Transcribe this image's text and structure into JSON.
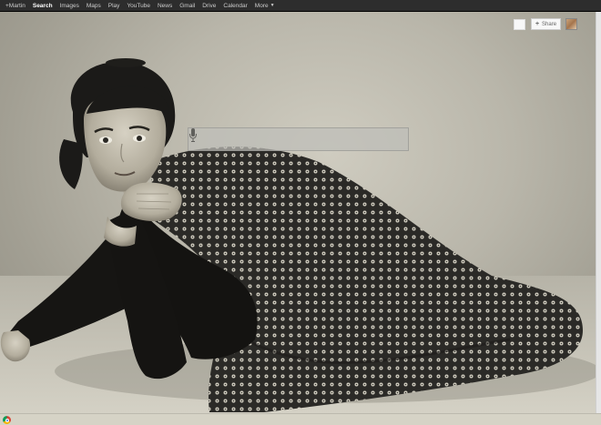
{
  "topbar": {
    "items": [
      {
        "label": "+Martin",
        "active": false
      },
      {
        "label": "Search",
        "active": true
      },
      {
        "label": "Images",
        "active": false
      },
      {
        "label": "Maps",
        "active": false
      },
      {
        "label": "Play",
        "active": false
      },
      {
        "label": "YouTube",
        "active": false
      },
      {
        "label": "News",
        "active": false
      },
      {
        "label": "Gmail",
        "active": false
      },
      {
        "label": "Drive",
        "active": false
      },
      {
        "label": "Calendar",
        "active": false
      },
      {
        "label": "More",
        "active": false
      }
    ]
  },
  "search": {
    "value": "",
    "placeholder": ""
  },
  "header_right": {
    "share_label": "Share"
  },
  "icons": {
    "mic": "microphone-icon",
    "share_plus": "plus-icon",
    "more_caret": "caret-down-icon",
    "browser_logo": "chrome-logo-icon"
  },
  "colors": {
    "topbar_bg": "#2d2d2d",
    "topbar_text": "#cccccc",
    "topbar_active": "#ffffff",
    "photo_tone": "#b9b6aa"
  }
}
